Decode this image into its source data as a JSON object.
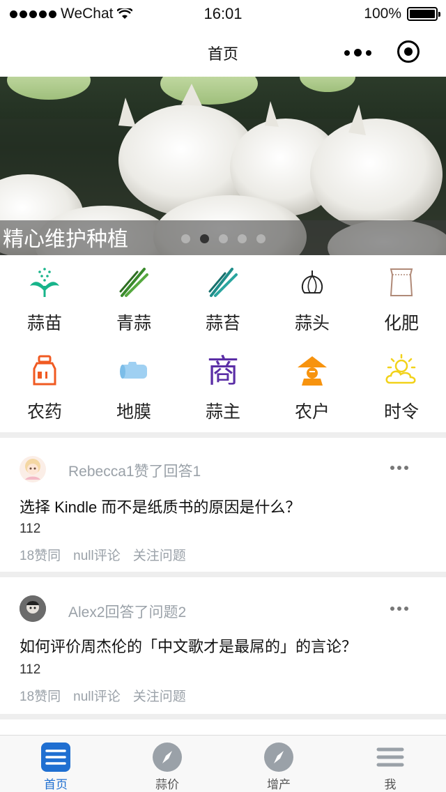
{
  "status_bar": {
    "carrier": "WeChat",
    "time": "16:01",
    "battery": "100%"
  },
  "nav": {
    "title": "首页"
  },
  "banner": {
    "caption": "精心维护种植",
    "slide_count": 5,
    "active_slide": 2
  },
  "categories": [
    {
      "label": "蒜苗",
      "icon": "sprout-icon"
    },
    {
      "label": "青蒜",
      "icon": "green-garlic-icon"
    },
    {
      "label": "蒜苔",
      "icon": "garlic-scape-icon"
    },
    {
      "label": "蒜头",
      "icon": "garlic-bulb-icon"
    },
    {
      "label": "化肥",
      "icon": "fertilizer-bag-icon"
    },
    {
      "label": "农药",
      "icon": "pesticide-bottle-icon"
    },
    {
      "label": "地膜",
      "icon": "mulch-film-icon"
    },
    {
      "label": "蒜主",
      "icon": "shop-icon",
      "glyph": "商"
    },
    {
      "label": "农户",
      "icon": "farmer-hat-icon"
    },
    {
      "label": "时令",
      "icon": "sun-cloud-icon"
    }
  ],
  "feed": [
    {
      "activity": "Rebecca1赞了回答1",
      "title": "选择 Kindle 而不是纸质书的原因是什么？",
      "excerpt": "112",
      "likes": "18赞同",
      "comments": "null评论",
      "follow": "关注问题"
    },
    {
      "activity": "Alex2回答了问题2",
      "title": "如何评价周杰伦的「中文歌才是最屌的」的言论？",
      "excerpt": "112",
      "likes": "18赞同",
      "comments": "null评论",
      "follow": "关注问题"
    }
  ],
  "tabs": [
    {
      "label": "首页",
      "icon": "home-list-icon",
      "active": true
    },
    {
      "label": "蒜价",
      "icon": "compass-icon",
      "active": false
    },
    {
      "label": "增产",
      "icon": "compass-icon",
      "active": false
    },
    {
      "label": "我",
      "icon": "menu-icon",
      "active": false
    }
  ],
  "colors": {
    "accent": "#1f6fd1",
    "muted_text": "#9aa1a8",
    "divider": "#eeeeee"
  }
}
